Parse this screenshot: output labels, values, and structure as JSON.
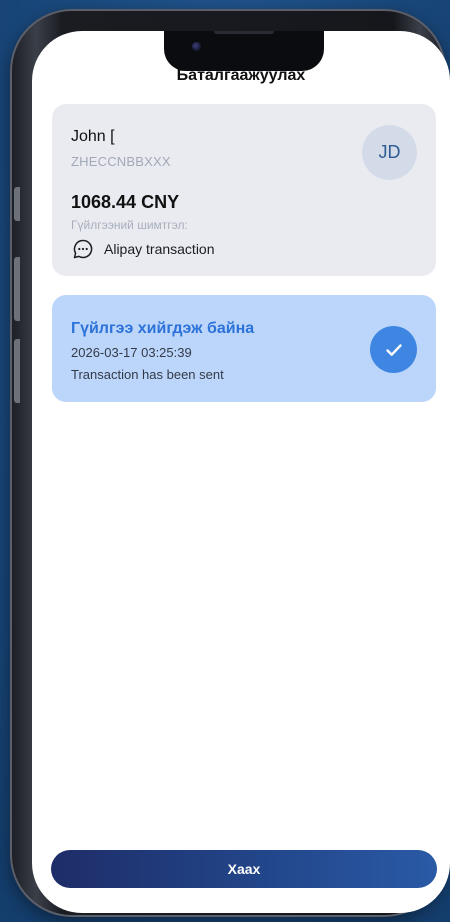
{
  "screen": {
    "title": "Баталгаажуулах"
  },
  "recipient": {
    "name": "John [",
    "code": "ZHECCNBBXXX",
    "initials": "JD",
    "amount": "1068.44 CNY",
    "description_label": "Гүйлгээний шимтгэл:",
    "description_icon": "chat-bubble-icon",
    "description": "Alipay transaction"
  },
  "status": {
    "title": "Гүйлгээ хийгдэж байна",
    "timestamp": "2026-03-17 03:25:39",
    "message": "Transaction has been sent",
    "icon": "check-icon"
  },
  "footer": {
    "close_label": "Хаах"
  },
  "colors": {
    "background": "#1d4f86",
    "status_card": "#bcd6fb",
    "status_accent": "#2c72d9",
    "check_badge": "#3f86e3",
    "button_start": "#1e2d68",
    "button_end": "#2a5aa6"
  }
}
